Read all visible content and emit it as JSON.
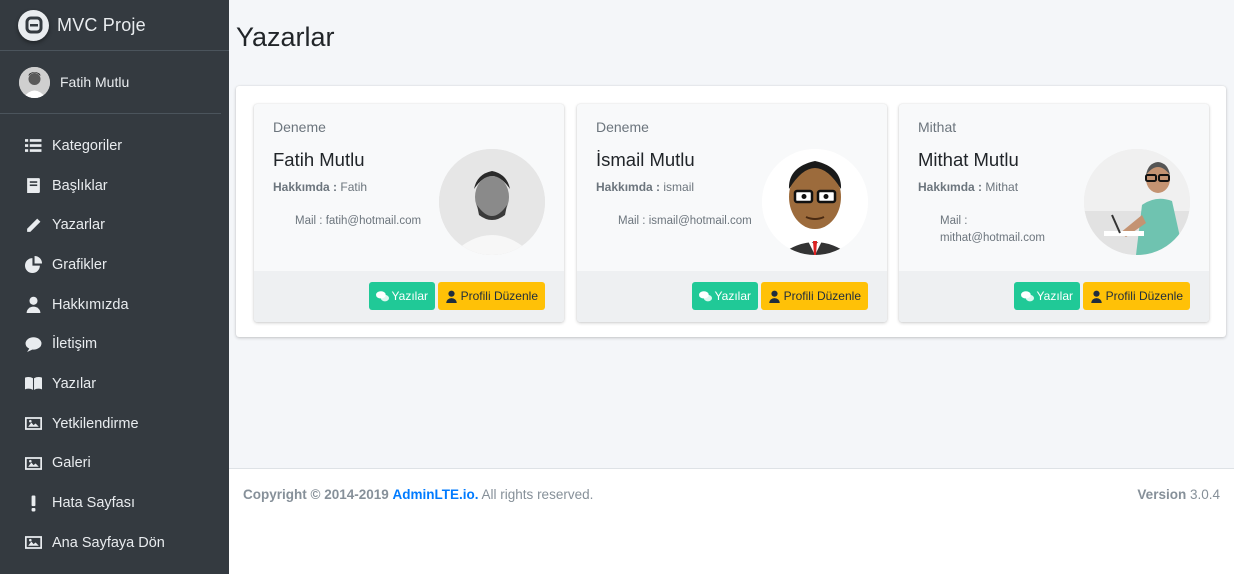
{
  "brand": {
    "title": "MVC Proje"
  },
  "user": {
    "name": "Fatih Mutlu"
  },
  "nav": [
    {
      "label": "Kategoriler",
      "icon": "list-icon"
    },
    {
      "label": "Başlıklar",
      "icon": "book-icon"
    },
    {
      "label": "Yazarlar",
      "icon": "pencil-icon"
    },
    {
      "label": "Grafikler",
      "icon": "pie-chart-icon"
    },
    {
      "label": "Hakkımızda",
      "icon": "user-icon"
    },
    {
      "label": "İletişim",
      "icon": "comment-icon"
    },
    {
      "label": "Yazılar",
      "icon": "open-book-icon"
    },
    {
      "label": "Yetkilendirme",
      "icon": "image-icon"
    },
    {
      "label": "Galeri",
      "icon": "image-icon"
    },
    {
      "label": "Hata Sayfası",
      "icon": "exclamation-icon"
    },
    {
      "label": "Ana Sayfaya Dön",
      "icon": "image-icon"
    }
  ],
  "page": {
    "title": "Yazarlar"
  },
  "authors": [
    {
      "header": "Deneme",
      "name": "Fatih Mutlu",
      "about_label": "Hakkımda :",
      "about": "Fatih",
      "mail_label": "Mail :",
      "mail": "fatih@hotmail.com",
      "posts_button": "Yazılar",
      "edit_button": "Profili Düzenle"
    },
    {
      "header": "Deneme",
      "name": "İsmail Mutlu",
      "about_label": "Hakkımda :",
      "about": "ismail",
      "mail_label": "Mail :",
      "mail": "ismail@hotmail.com",
      "posts_button": "Yazılar",
      "edit_button": "Profili Düzenle"
    },
    {
      "header": "Mithat",
      "name": "Mithat Mutlu",
      "about_label": "Hakkımda :",
      "about": "Mithat",
      "mail_label": "Mail :",
      "mail": "mithat@hotmail.com",
      "posts_button": "Yazılar",
      "edit_button": "Profili Düzenle"
    }
  ],
  "footer": {
    "copyright_prefix": "Copyright © 2014-2019",
    "link": "AdminLTE.io.",
    "rights": "All rights reserved.",
    "version_label": "Version",
    "version": "3.0.4"
  },
  "colors": {
    "sidebar": "#343a40",
    "posts_button": "#20c997",
    "edit_button": "#ffc107",
    "link": "#007bff"
  }
}
